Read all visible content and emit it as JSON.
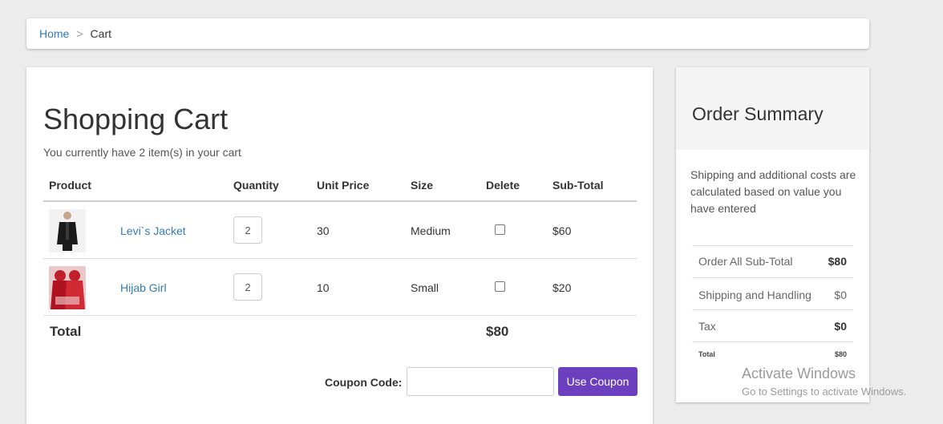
{
  "breadcrumb": {
    "home": "Home",
    "separator": ">",
    "current": "Cart"
  },
  "cart": {
    "title": "Shopping Cart",
    "count_text": "You currently have 2 item(s) in your cart",
    "headers": [
      "Product",
      "Quantity",
      "Unit Price",
      "Size",
      "Delete",
      "Sub-Total"
    ],
    "items": [
      {
        "name": "Levi`s Jacket",
        "quantity": "2",
        "unit_price": "30",
        "size": "Medium",
        "subtotal": "$60",
        "image_icon": "jacket-photo"
      },
      {
        "name": "Hijab Girl",
        "quantity": "2",
        "unit_price": "10",
        "size": "Small",
        "subtotal": "$20",
        "image_icon": "hijab-photo"
      }
    ],
    "total_label": "Total",
    "total_value": "$80",
    "coupon_label": "Coupon Code:",
    "coupon_value": "",
    "coupon_button": "Use Coupon"
  },
  "summary": {
    "title": "Order Summary",
    "note": "Shipping and additional costs are calculated based on value you have entered",
    "rows": [
      {
        "label": "Order All Sub-Total",
        "value": "$80"
      },
      {
        "label": "Shipping and Handling",
        "value": "$0"
      },
      {
        "label": "Tax",
        "value": "$0"
      }
    ],
    "total_label": "Total",
    "total_value": "$80"
  },
  "watermark": {
    "line1": "Activate Windows",
    "line2": "Go to Settings to activate Windows."
  },
  "colors": {
    "link": "#337ab7",
    "button": "#6b3fbd",
    "background": "#ececec"
  }
}
